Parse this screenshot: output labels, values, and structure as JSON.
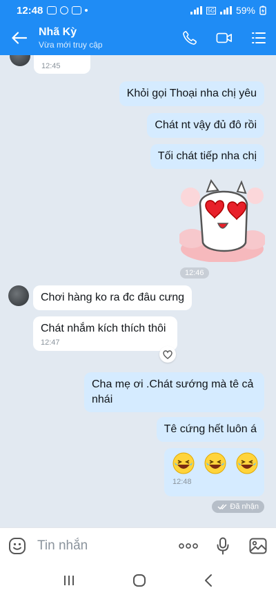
{
  "status_bar": {
    "time": "12:48",
    "battery": "59%",
    "network": "5G"
  },
  "header": {
    "name": "Nhã Kỳ",
    "status": "Vừa mới truy cập"
  },
  "messages": {
    "m0": {
      "time": "12:45"
    },
    "m1": {
      "text": "Khỏi gọi Thoại nha chị yêu"
    },
    "m2": {
      "text": "Chát nt vậy đủ đô rồi"
    },
    "m3": {
      "text": "Tối chát tiếp nha chị"
    },
    "sticker_time": "12:46",
    "m4": {
      "text": "Chơi hàng ko ra đc đâu cưng"
    },
    "m5": {
      "text": "Chát nhắm kích thích thôi",
      "time": "12:47"
    },
    "m6": {
      "text": "Cha mẹ ơi .Chát sướng mà tê cả nhái"
    },
    "m7": {
      "text": "Tê cứng hết luôn á"
    },
    "m8": {
      "time": "12:48"
    },
    "seen": "Đã nhận"
  },
  "input": {
    "placeholder": "Tin nhắn"
  },
  "icons": {
    "back": "arrow-left-icon",
    "call": "phone-icon",
    "video": "video-icon",
    "menu": "list-menu-icon",
    "emoji": "emoji-icon",
    "more": "more-icon",
    "mic": "microphone-icon",
    "image": "image-icon",
    "heart": "heart-icon"
  },
  "colors": {
    "header": "#1f8cf5",
    "outgoing_bubble": "#d5ebff",
    "incoming_bubble": "#ffffff",
    "chat_background": "#e2e9f1"
  }
}
